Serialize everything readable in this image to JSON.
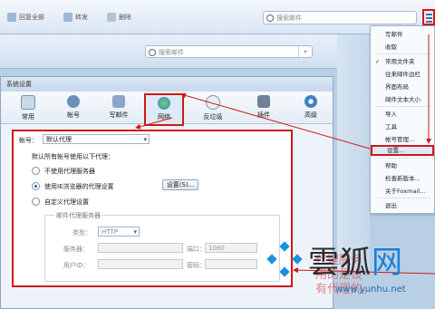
{
  "toolbar": {
    "reply_all": "回复全部",
    "forward": "转发",
    "delete": "删除",
    "search_placeholder": "搜索邮件"
  },
  "bar2": {
    "search_placeholder": "搜索邮件"
  },
  "dialog": {
    "title": "系统设置",
    "tabs": [
      {
        "label": "常用",
        "icon": "document-icon"
      },
      {
        "label": "帐号",
        "icon": "user-icon"
      },
      {
        "label": "写邮件",
        "icon": "compose-icon"
      },
      {
        "label": "网络",
        "icon": "globe-icon"
      },
      {
        "label": "反垃圾",
        "icon": "shield-icon"
      },
      {
        "label": "插件",
        "icon": "plugin-icon"
      },
      {
        "label": "高级",
        "icon": "gear-icon"
      }
    ],
    "account_label": "帐号：",
    "account_value": "默认代理",
    "proxy_heading": "默认所有帐号使用以下代理：",
    "options": [
      {
        "label": "不使用代理服务器",
        "selected": false
      },
      {
        "label": "使用IE浏览器的代理设置",
        "selected": true
      },
      {
        "label": "自定义代理设置",
        "selected": false
      }
    ],
    "settings_button": "设置(S)...",
    "group_title": "邮件代理服务器",
    "type_label": "类型：",
    "type_value": "HTTP",
    "server_label": "服务器：",
    "port_label": "端口：",
    "port_value": "1080",
    "userid_label": "用户ID：",
    "password_label": "密码："
  },
  "menu": {
    "items": [
      {
        "label": "写邮件",
        "checked": false
      },
      {
        "label": "收取",
        "checked": false
      },
      {
        "label": "常用文件夹",
        "checked": true
      },
      {
        "label": "往来邮件边栏",
        "checked": false
      },
      {
        "label": "界面布局",
        "checked": false
      },
      {
        "label": "邮件文本大小",
        "checked": false
      },
      {
        "label": "导入",
        "checked": false
      },
      {
        "label": "工具",
        "checked": false
      },
      {
        "label": "帐号管理...",
        "checked": false
      },
      {
        "label": "设置...",
        "checked": false,
        "highlighted": true
      },
      {
        "label": "帮助",
        "checked": false
      },
      {
        "label": "检查新版本...",
        "checked": false
      },
      {
        "label": "关于Foxmail...",
        "checked": false
      },
      {
        "label": "退出",
        "checked": false
      }
    ]
  },
  "watermark": {
    "brand_part1": "雲狐",
    "brand_part2": "网",
    "url": "www.yunhu.net",
    "note_line1": "代理服务",
    "note_line2": "用的是设",
    "note_line3": "有代理的。"
  },
  "colors": {
    "highlight_red": "#d01818",
    "accent_blue": "#2d5fa0"
  }
}
